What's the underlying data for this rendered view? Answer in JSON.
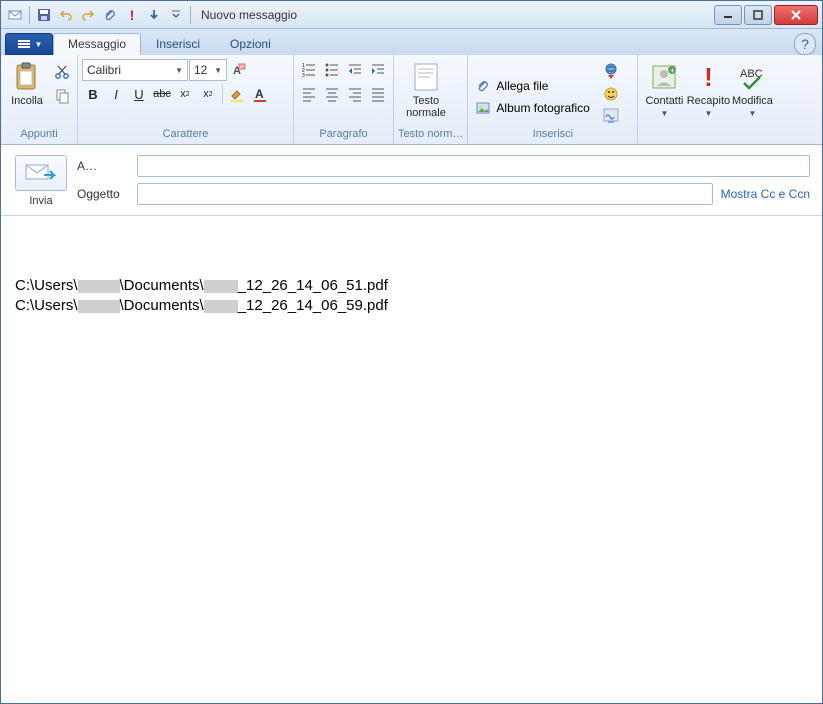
{
  "window": {
    "title": "Nuovo messaggio"
  },
  "tabs": {
    "messaggio": "Messaggio",
    "inserisci": "Inserisci",
    "opzioni": "Opzioni"
  },
  "groups": {
    "appunti": "Appunti",
    "carattere": "Carattere",
    "paragrafo": "Paragrafo",
    "testo_normale": "Testo norm…",
    "inserisci": "Inserisci"
  },
  "ribbon": {
    "incolla": "Incolla",
    "font_name": "Calibri",
    "font_size": "12",
    "testo_normale_line1": "Testo",
    "testo_normale_line2": "normale",
    "allega_file": "Allega file",
    "album_foto": "Album fotografico",
    "contatti": "Contatti",
    "recapito": "Recapito",
    "modifica": "Modifica"
  },
  "compose": {
    "invia": "Invia",
    "a_label": "A…",
    "oggetto_label": "Oggetto",
    "a_value": "",
    "oggetto_value": "",
    "show_cc": "Mostra Cc e Ccn"
  },
  "body": {
    "line1_pre": "C:\\Users\\",
    "line1_mid": "\\Documents\\",
    "line1_post": "_12_26_14_06_51.pdf",
    "line2_pre": "C:\\Users\\",
    "line2_mid": "\\Documents\\",
    "line2_post": "_12_26_14_06_59.pdf"
  }
}
